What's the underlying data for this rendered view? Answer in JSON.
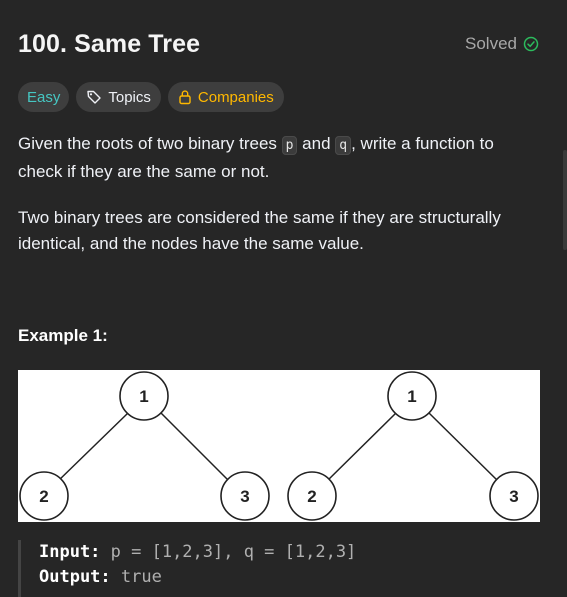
{
  "problem": {
    "title": "100. Same Tree",
    "status_label": "Solved",
    "status_icon": "check-circle-icon",
    "status_color": "#2cbb5d"
  },
  "tags": {
    "difficulty": "Easy",
    "topics": "Topics",
    "companies": "Companies",
    "difficulty_color": "#46c6c2",
    "companies_color": "#ffb800"
  },
  "description": {
    "p1_before": "Given the roots of two binary trees ",
    "p1_var_p": "p",
    "p1_and": " and ",
    "p1_var_q": "q",
    "p1_after": ", write a function to check if they are the same or not.",
    "p2": "Two binary trees are considered the same if they are structurally identical, and the nodes have the same value."
  },
  "example": {
    "title": "Example 1:",
    "tree_p": {
      "root": "1",
      "left": "2",
      "right": "3"
    },
    "tree_q": {
      "root": "1",
      "left": "2",
      "right": "3"
    },
    "input_label": "Input:",
    "input_value": " p = [1,2,3], q = [1,2,3]",
    "output_label": "Output:",
    "output_value": " true"
  }
}
